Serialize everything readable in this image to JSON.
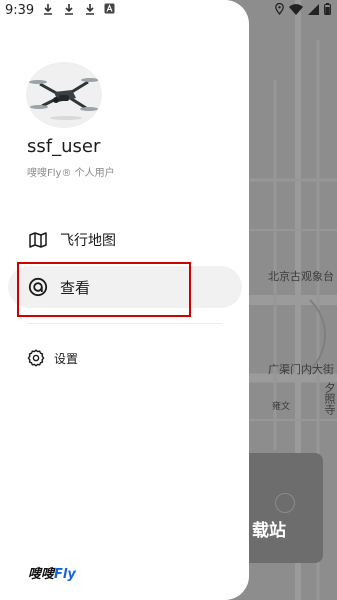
{
  "status_bar": {
    "time": "9:39",
    "left_icons": [
      "download-icon",
      "download-icon",
      "download-icon",
      "app-a-icon"
    ],
    "right_icons": [
      "location-icon",
      "wifi-icon",
      "signal-icon",
      "battery-icon"
    ]
  },
  "map": {
    "labels": {
      "beijing_observatory": "北京古观象台",
      "guangqumen": "广渠门内大街",
      "small_label": "雍文",
      "vertical_label": "夕照寺"
    },
    "card_text": "载站"
  },
  "drawer": {
    "profile": {
      "username": "ssf_user",
      "subtitle": "嗖嗖Fly® 个人用户"
    },
    "menu": {
      "flight_map": "飞行地图",
      "view": "查看",
      "settings": "设置"
    },
    "brand": {
      "prefix": "嗖嗖",
      "suffix": "Fly"
    }
  },
  "colors": {
    "highlight": "#d00000",
    "brand_blue": "#1565d8",
    "overlay": "#8b8b8b"
  }
}
